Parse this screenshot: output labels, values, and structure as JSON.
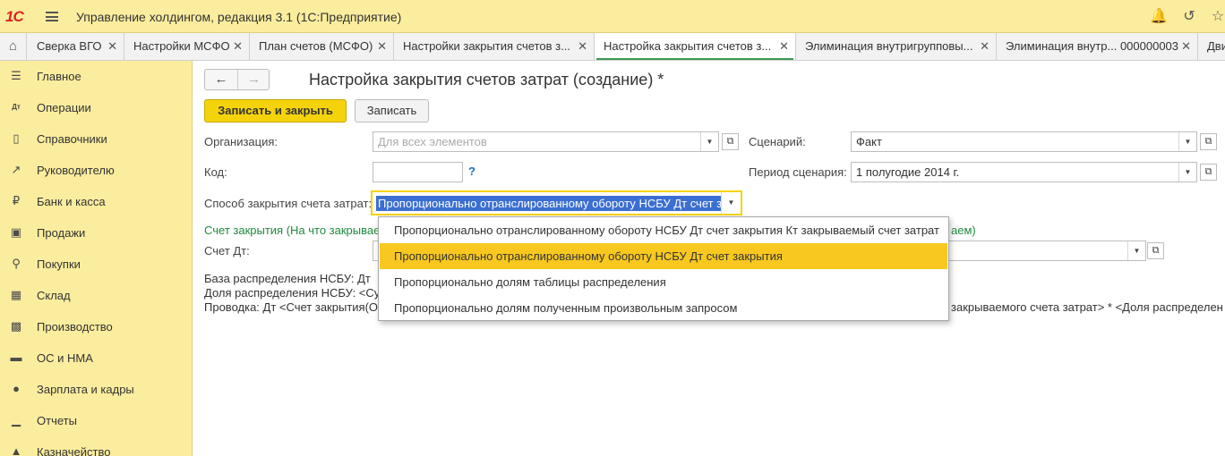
{
  "app": {
    "logo": "1С",
    "title": "Управление холдингом, редакция 3.1  (1С:Предприятие)"
  },
  "toolbar_icons": [
    "bell-icon",
    "history-icon",
    "star-icon"
  ],
  "tabs": [
    {
      "label": "Сверка ВГО",
      "close": "✕"
    },
    {
      "label": "Настройки МСФО",
      "close": "✕"
    },
    {
      "label": "План счетов (МСФО)",
      "close": "✕"
    },
    {
      "label": "Настройки закрытия счетов з...",
      "close": "✕"
    },
    {
      "label": "Настройка закрытия счетов з...",
      "close": "✕"
    },
    {
      "label": "Элиминация внутригрупповы...",
      "close": "✕"
    },
    {
      "label": "Элиминация внутр... 000000003",
      "close": "✕"
    },
    {
      "label": "Дви",
      "close": ""
    }
  ],
  "sidebar": {
    "items": [
      {
        "label": "Главное",
        "icon": "menu-lines-icon"
      },
      {
        "label": "Операции",
        "icon": "dt-kt-icon"
      },
      {
        "label": "Справочники",
        "icon": "books-icon"
      },
      {
        "label": "Руководителю",
        "icon": "trend-chart-icon"
      },
      {
        "label": "Банк и касса",
        "icon": "ruble-coin-icon"
      },
      {
        "label": "Продажи",
        "icon": "shopping-bag-icon"
      },
      {
        "label": "Покупки",
        "icon": "cart-icon"
      },
      {
        "label": "Склад",
        "icon": "warehouse-grid-icon"
      },
      {
        "label": "Производство",
        "icon": "factory-icon"
      },
      {
        "label": "ОС и НМА",
        "icon": "truck-icon"
      },
      {
        "label": "Зарплата и кадры",
        "icon": "person-icon"
      },
      {
        "label": "Отчеты",
        "icon": "bar-chart-icon"
      },
      {
        "label": "Казначейство",
        "icon": "treasury-icon"
      }
    ]
  },
  "form": {
    "title": "Настройка закрытия счетов затрат (создание) *",
    "save_close_label": "Записать и закрыть",
    "save_label": "Записать",
    "organization_label": "Организация:",
    "organization_placeholder": "Для всех элементов",
    "code_label": "Код:",
    "code_value": "",
    "help_mark": "?",
    "scenario_label": "Сценарий:",
    "scenario_value": "Факт",
    "period_label": "Период сценария:",
    "period_value": "1 полугодие 2014 г.",
    "method_label": "Способ закрытия счета затрат:",
    "method_value": "Пропорционально отранслированному обороту НСБУ Дт счет з",
    "closing_account_label_left": "Счет закрытия (На что закрывае",
    "closing_account_label_right": "аем)",
    "account_dt_label": "Счет Дт:",
    "desc_base_left": "База распределения НСБУ: Дт",
    "desc_share_left": "Доля распределения НСБУ: <Су",
    "desc_posting_left": "Проводка: Дт <Счет закрытия(О",
    "desc_posting_right": "закрываемого счета затрат> * <Доля распределен"
  },
  "dropdown": {
    "options": [
      "Пропорционально отранслированному обороту НСБУ Дт счет закрытия Кт закрываемый счет затрат",
      "Пропорционально отранслированному обороту НСБУ Дт счет закрытия",
      "Пропорционально долям таблицы распределения",
      "Пропорционально долям полученным произвольным запросом"
    ],
    "selected_index": 1
  },
  "colors": {
    "panel_yellow": "#fbed9e",
    "primary_button": "#f5d30b",
    "selected_option": "#f8c820",
    "accent_green": "#1e8a3d",
    "selection_blue": "#3b6fd1"
  }
}
